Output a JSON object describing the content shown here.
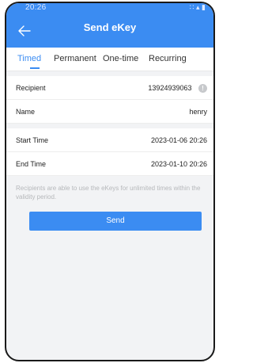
{
  "status_bar": {
    "time": "20:26",
    "icons": "∷ ▴ ▮"
  },
  "header": {
    "title": "Send eKey",
    "back_icon": "back-arrow-icon"
  },
  "tabs": [
    {
      "label": "Timed",
      "active": true
    },
    {
      "label": "Permanent",
      "active": false
    },
    {
      "label": "One-time",
      "active": false
    },
    {
      "label": "Recurring",
      "active": false
    }
  ],
  "form": {
    "recipient": {
      "label": "Recipient",
      "value": "13924939063",
      "icon": "info-icon"
    },
    "name": {
      "label": "Name",
      "value": "henry"
    },
    "start_time": {
      "label": "Start Time",
      "value": "2023-01-06 20:26"
    },
    "end_time": {
      "label": "End Time",
      "value": "2023-01-10 20:26"
    }
  },
  "note": "Recipients are able to use the eKeys for unlimited times within the validity period.",
  "send_button": {
    "label": "Send"
  },
  "colors": {
    "accent": "#3b8cf2",
    "background": "#f2f3f5",
    "note_text": "#b6b8bb"
  }
}
